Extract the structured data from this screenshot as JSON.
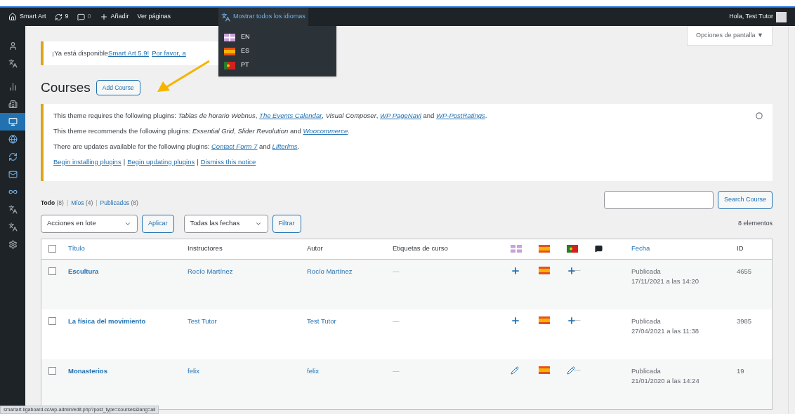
{
  "admin_bar": {
    "site": "Smart Art",
    "updates": "9",
    "comments": "0",
    "new": "Añadir",
    "view": "Ver páginas",
    "languages": {
      "label": "Mostrar todos los idiomas",
      "expanded": true,
      "items": [
        {
          "kind": "gb",
          "label": "EN"
        },
        {
          "kind": "es",
          "label": "ES"
        },
        {
          "kind": "pt",
          "label": "PT"
        }
      ]
    },
    "greeting": "Hola, Test Tutor"
  },
  "sidebar": {
    "items": [
      {
        "selected": false
      },
      {
        "selected": false
      },
      {
        "selected": false
      },
      {
        "selected": false
      },
      {
        "selected": true
      },
      {
        "selected": false
      },
      {
        "selected": false
      },
      {
        "selected": false
      },
      {
        "selected": false
      },
      {
        "selected": false
      },
      {
        "selected": false
      },
      {
        "selected": false
      }
    ]
  },
  "screen_options": "Opciones de pantalla ▼",
  "update_notice": {
    "text": "¡Ya está disponible ",
    "link": "Smart Art 5.9!",
    "link2": "Por favor, a"
  },
  "heading": {
    "title": "Courses",
    "button": "Add Course"
  },
  "plugin_notice": {
    "lines": [
      [
        {
          "kind": "text",
          "text": "This theme requires the following plugins: *Tablas de horario Webnus*, "
        },
        {
          "kind": "link",
          "text": "The Events Calendar"
        },
        {
          "kind": "text",
          "text": ", *Visual Composer*, "
        },
        {
          "kind": "link",
          "text": "WP PageNavi"
        },
        {
          "kind": "text",
          "text": " and "
        },
        {
          "kind": "link",
          "text": "WP-PostRatings"
        },
        {
          "kind": "text",
          "text": "."
        }
      ],
      [
        {
          "kind": "text",
          "text": "This theme recommends the following plugins: *Essential Grid*, *Slider Revolution* and "
        },
        {
          "kind": "link",
          "text": "Woocommerce"
        },
        {
          "kind": "text",
          "text": "."
        }
      ],
      [
        {
          "kind": "text",
          "text": "There are updates available for the following plugins: "
        },
        {
          "kind": "link",
          "text": "Contact Form 7"
        },
        {
          "kind": "text",
          "text": " and "
        },
        {
          "kind": "link",
          "text": "Lifterlms"
        },
        {
          "kind": "text",
          "text": "."
        }
      ]
    ],
    "actions": [
      {
        "kind": "link",
        "text": "Begin installing plugins"
      },
      {
        "kind": "separator",
        "text": "|"
      },
      {
        "kind": "link",
        "text": "Begin updating plugins"
      },
      {
        "kind": "separator",
        "text": "|"
      },
      {
        "kind": "link",
        "text": "Dismiss this notice"
      }
    ]
  },
  "views": [
    {
      "label": "Todo",
      "count": "(8)",
      "selected": true
    },
    {
      "separator": "|",
      "label": "Míos",
      "count": "(4)",
      "selected": false
    },
    {
      "separator": "|",
      "label": "Publicados",
      "count": "(8)",
      "selected": false
    }
  ],
  "search": {
    "button": "Search Course"
  },
  "bulk": {
    "value": "Acciones en lote",
    "apply": "Aplicar"
  },
  "dates": {
    "value": "Todas las fechas",
    "filter": "Filtrar"
  },
  "count": "8 elementos",
  "table": {
    "select_all": {
      "checked": false
    },
    "columns": {
      "title": "Título",
      "instructors": "Instructores",
      "author": "Autor",
      "tags": "Etiquetas de curso",
      "langs": [
        {
          "kind": "gb"
        },
        {
          "kind": "es"
        },
        {
          "kind": "pt"
        }
      ],
      "date": "Fecha",
      "id": "ID"
    },
    "rows": [
      {
        "checked": false,
        "title": "Escultura",
        "instructors": "Rocío Martínez",
        "author": "Rocío Martínez",
        "tags": "—",
        "translations": [
          {
            "kind": "add"
          },
          {
            "kind": "current"
          },
          {
            "kind": "add"
          }
        ],
        "comments": "—",
        "status": "Publicada",
        "date": "17/11/2021 a las 14:20",
        "id": "4655"
      },
      {
        "checked": false,
        "title": "La física del movimiento",
        "instructors": "Test Tutor",
        "author": "Test Tutor",
        "tags": "—",
        "translations": [
          {
            "kind": "add"
          },
          {
            "kind": "current"
          },
          {
            "kind": "add"
          }
        ],
        "comments": "—",
        "status": "Publicada",
        "date": "27/04/2021 a las 11:38",
        "id": "3985"
      },
      {
        "checked": false,
        "title": "Monasterios",
        "instructors": "felix",
        "author": "felix",
        "tags": "—",
        "translations": [
          {
            "kind": "edit"
          },
          {
            "kind": "current"
          },
          {
            "kind": "edit"
          }
        ],
        "comments": "—",
        "status": "Publicada",
        "date": "21/01/2020 a las 14:24",
        "id": "19"
      }
    ]
  },
  "status_url": "smartart.ligaboard.cc/wp-admin/edit.php?post_type=courses&lang=all"
}
